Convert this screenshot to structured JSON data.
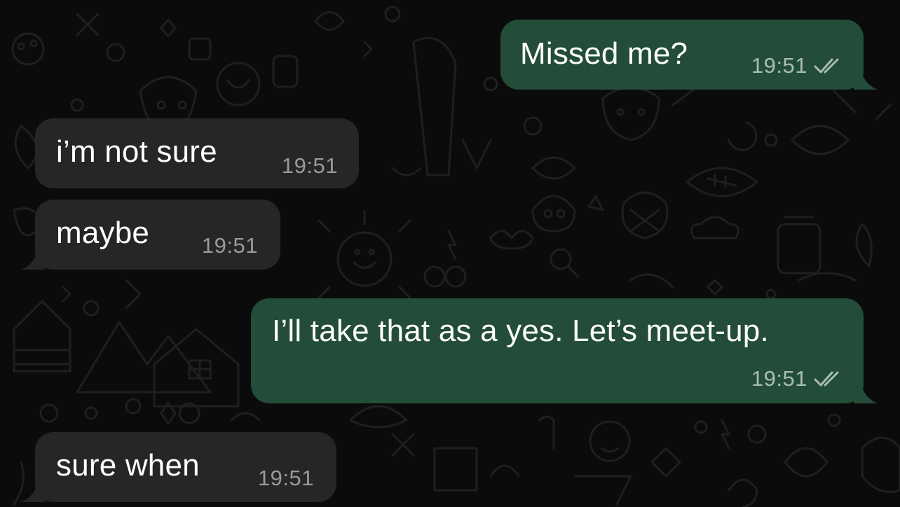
{
  "conversation": {
    "messages": [
      {
        "direction": "outgoing",
        "text": "Missed me?",
        "time": "19:51",
        "status": "read",
        "status_icon": "double-check-icon"
      },
      {
        "direction": "incoming",
        "text": "i’m not sure",
        "time": "19:51"
      },
      {
        "direction": "incoming",
        "text": "maybe",
        "time": "19:51"
      },
      {
        "direction": "outgoing",
        "text": "I’ll take that as a yes. Let’s meet-up.",
        "time": "19:51",
        "status": "read",
        "status_icon": "double-check-icon"
      },
      {
        "direction": "incoming",
        "text": "sure when",
        "time": "19:51"
      }
    ]
  },
  "colors": {
    "background": "#0b0b0b",
    "incoming_bubble": "#262626",
    "outgoing_bubble": "#234d38",
    "message_text": "#ffffff",
    "timestamp": "#9a9a9a",
    "outgoing_timestamp": "#a9bdb2",
    "wallpaper_doodle": "#1f1f1f"
  }
}
